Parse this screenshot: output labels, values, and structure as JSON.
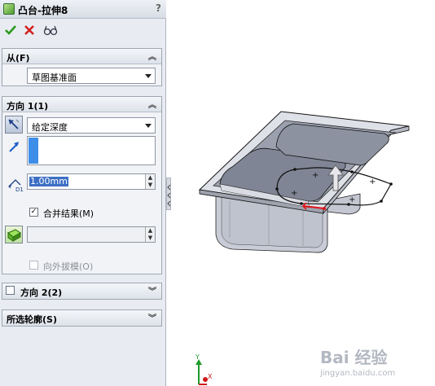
{
  "feature": {
    "title": "凸台-拉伸8",
    "help": "?",
    "ok_icon": "checkmark-icon",
    "cancel_icon": "x-icon",
    "preview_icon": "eyeglasses-icon"
  },
  "from_group": {
    "header": "从(F)",
    "value": "草图基准面"
  },
  "direction1": {
    "header": "方向 1(1)",
    "end_condition": "给定深度",
    "depth": "1.00mm",
    "merge_label": "合并结果(M)",
    "merge_checked": "✓",
    "draft_outward_label": "向外拔模(O)"
  },
  "direction2": {
    "header": "方向 2(2)"
  },
  "contours": {
    "header": "所选轮廓(S)"
  },
  "viewport": {
    "axis_y": "Y",
    "axis_x": "X",
    "watermark": "Bai 经验",
    "watermark_sub": "jingyan.baidu.com"
  },
  "colors": {
    "accent": "#3d6fc4",
    "ok": "#2b9a1f",
    "cancel": "#d42020",
    "panel_bg": "#e8ecf2"
  }
}
